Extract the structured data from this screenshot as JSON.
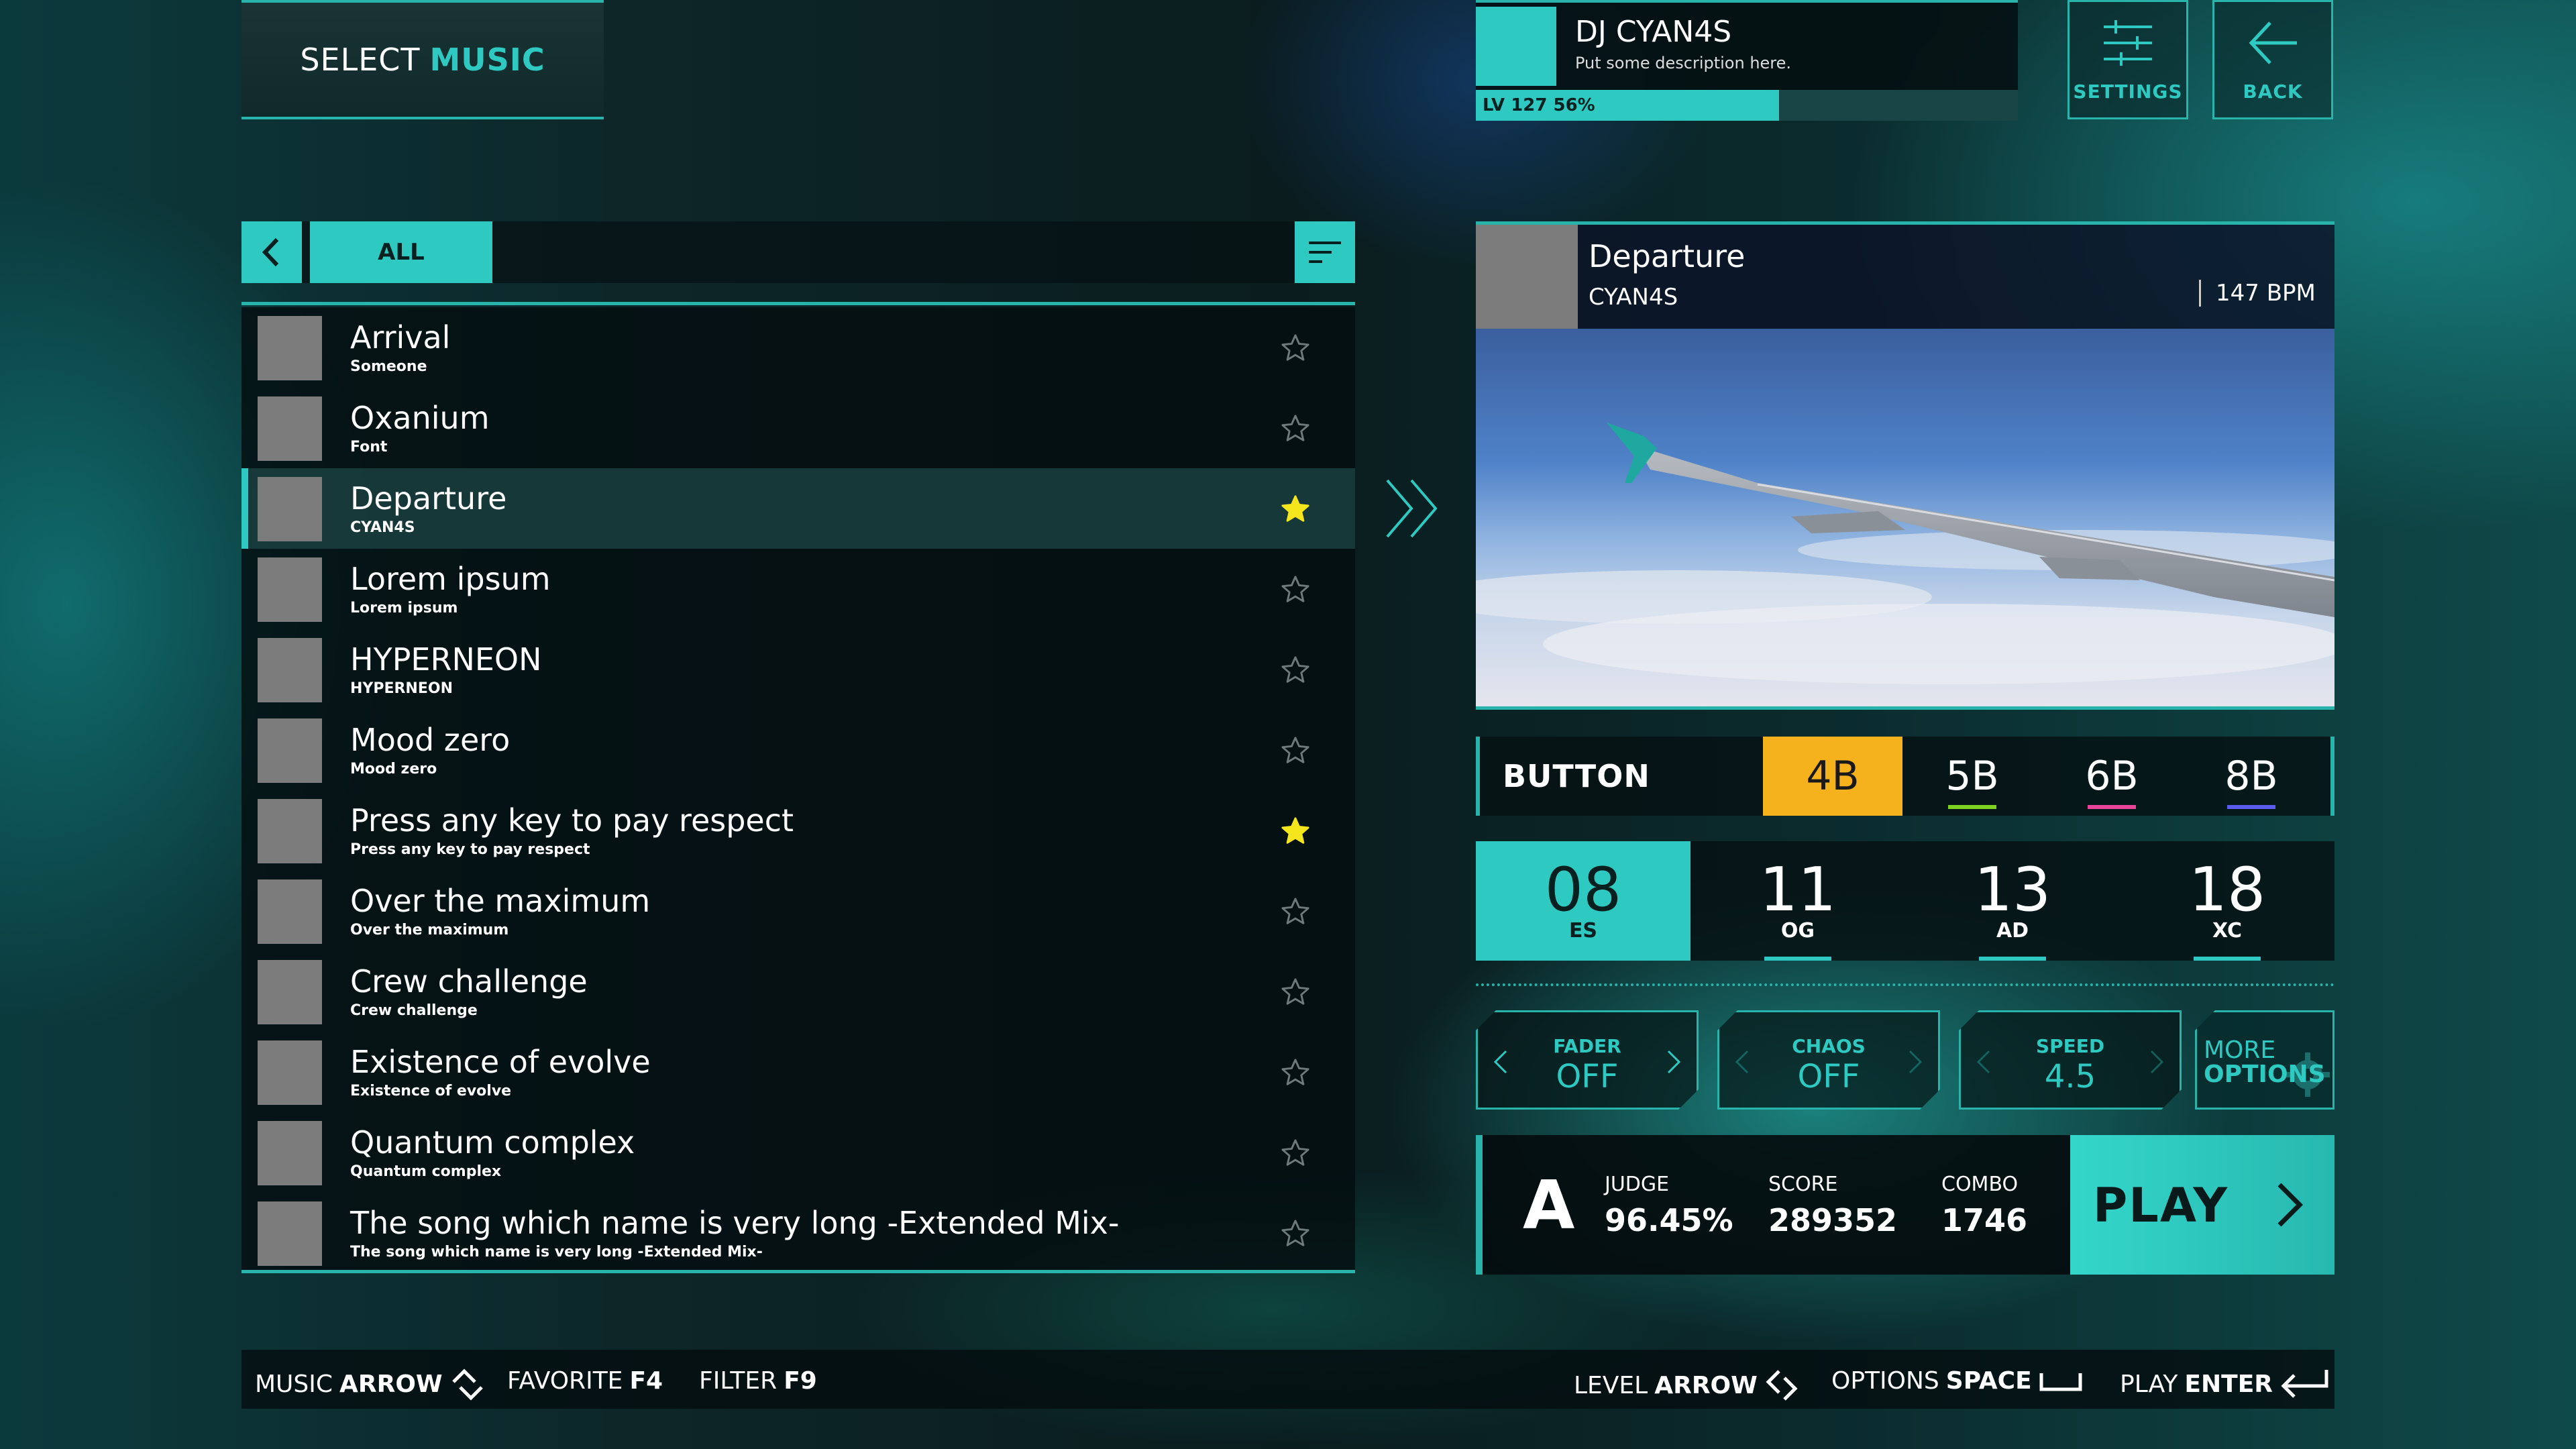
{
  "header": {
    "title_prefix": "SELECT",
    "title_suffix": "MUSIC"
  },
  "profile": {
    "name": "DJ CYAN4S",
    "description": "Put some description here.",
    "level_text": "LV 127 56%",
    "level_progress": 0.56
  },
  "toolbar": {
    "settings_label": "SETTINGS",
    "back_label": "BACK"
  },
  "filter": {
    "active_tab": "ALL",
    "prev_icon": "chevron-left-icon",
    "sort_icon": "sort-icon"
  },
  "songs": [
    {
      "title": "Arrival",
      "artist": "Someone",
      "favorite": false
    },
    {
      "title": "Oxanium",
      "artist": "Font",
      "favorite": false
    },
    {
      "title": "Departure",
      "artist": "CYAN4S",
      "favorite": true,
      "selected": true
    },
    {
      "title": "Lorem ipsum",
      "artist": "Lorem ipsum",
      "favorite": false
    },
    {
      "title": "HYPERNEON",
      "artist": "HYPERNEON",
      "favorite": false
    },
    {
      "title": "Mood zero",
      "artist": "Mood zero",
      "favorite": false
    },
    {
      "title": "Press any key to pay respect",
      "artist": "Press any key to pay respect",
      "favorite": true
    },
    {
      "title": "Over the maximum",
      "artist": "Over the maximum",
      "favorite": false
    },
    {
      "title": "Crew challenge",
      "artist": "Crew challenge",
      "favorite": false
    },
    {
      "title": "Existence of evolve",
      "artist": "Existence of evolve",
      "favorite": false
    },
    {
      "title": "Quantum complex",
      "artist": "Quantum complex",
      "favorite": false
    },
    {
      "title": "The song which name is very long -Extended Mix-",
      "artist": "The song which name is very long -Extended Mix-",
      "favorite": false
    }
  ],
  "detail": {
    "title": "Departure",
    "artist": "CYAN4S",
    "bpm": "147 BPM"
  },
  "buttons": {
    "label": "BUTTON",
    "modes": [
      {
        "label": "4B",
        "active": true,
        "color": "#f5b21c"
      },
      {
        "label": "5B",
        "color": "#7ed321"
      },
      {
        "label": "6B",
        "color": "#e8459a"
      },
      {
        "label": "8B",
        "color": "#5b5bf0"
      }
    ]
  },
  "difficulties": [
    {
      "level": "08",
      "code": "ES",
      "active": true
    },
    {
      "level": "11",
      "code": "OG"
    },
    {
      "level": "13",
      "code": "AD"
    },
    {
      "level": "18",
      "code": "XC"
    }
  ],
  "options": [
    {
      "name": "FADER",
      "value": "OFF"
    },
    {
      "name": "CHAOS",
      "value": "OFF"
    },
    {
      "name": "SPEED",
      "value": "4.5"
    }
  ],
  "more_options": {
    "line1": "MORE",
    "line2": "OPTIONS"
  },
  "result": {
    "rank": "A",
    "judge_label": "JUDGE",
    "judge_value": "96.45%",
    "score_label": "SCORE",
    "score_value": "289352",
    "combo_label": "COMBO",
    "combo_value": "1746"
  },
  "play": {
    "label": "PLAY"
  },
  "hints": {
    "music": {
      "label": "MUSIC",
      "key": "ARROW"
    },
    "favorite": {
      "label": "FAVORITE",
      "key": "F4"
    },
    "filter": {
      "label": "FILTER",
      "key": "F9"
    },
    "level": {
      "label": "LEVEL",
      "key": "ARROW"
    },
    "options": {
      "label": "OPTIONS",
      "key": "SPACE"
    },
    "play": {
      "label": "PLAY",
      "key": "ENTER"
    }
  },
  "colors": {
    "accent": "#2ec9c0",
    "favorite_star": "#f5e51c",
    "thumb": "#7c7c7c"
  }
}
